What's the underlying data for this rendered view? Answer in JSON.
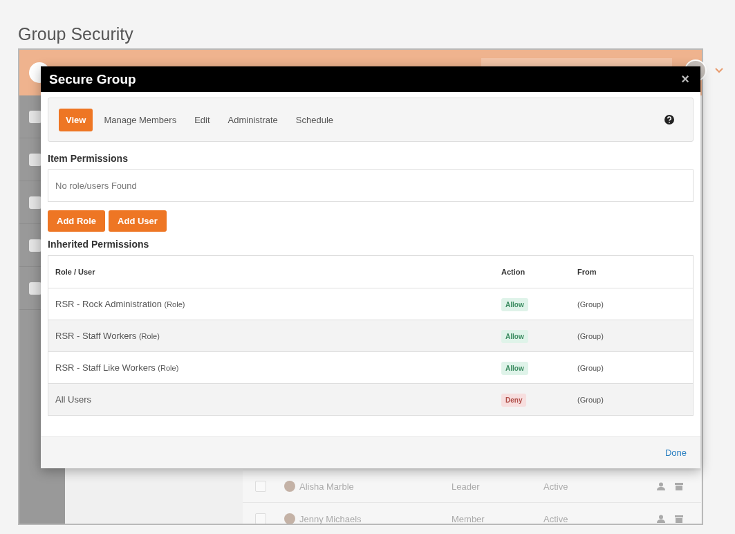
{
  "page_title": "Group Security",
  "modal": {
    "title": "Secure Group",
    "close": "×",
    "tabs": [
      {
        "label": "View",
        "selected": true
      },
      {
        "label": "Manage Members",
        "selected": false
      },
      {
        "label": "Edit",
        "selected": false
      },
      {
        "label": "Administrate",
        "selected": false
      },
      {
        "label": "Schedule",
        "selected": false
      }
    ],
    "item_permissions": {
      "heading": "Item Permissions",
      "empty_text": "No role/users Found"
    },
    "buttons": [
      "Add Role",
      "Add User"
    ],
    "inherited": {
      "heading": "Inherited Permissions",
      "columns": [
        "Role / User",
        "Action",
        "From"
      ],
      "rows": [
        {
          "name": "RSR - Rock Administration",
          "type": "(Role)",
          "action": "Allow",
          "kind": "allow",
          "from": "(Group)"
        },
        {
          "name": "RSR - Staff Workers",
          "type": "(Role)",
          "action": "Allow",
          "kind": "allow",
          "from": "(Group)"
        },
        {
          "name": "RSR - Staff Like Workers",
          "type": "(Role)",
          "action": "Allow",
          "kind": "allow",
          "from": "(Group)"
        },
        {
          "name": "All Users",
          "action": "Deny",
          "kind": "deny",
          "from": "(Group)"
        }
      ]
    },
    "footer_link": "Done"
  },
  "background_members": [
    {
      "name": "Alisha Marble",
      "role": "Leader",
      "status": "Active",
      "checked": false
    },
    {
      "name": "Jenny Michaels",
      "role": "Member",
      "status": "Active",
      "checked": false
    }
  ]
}
